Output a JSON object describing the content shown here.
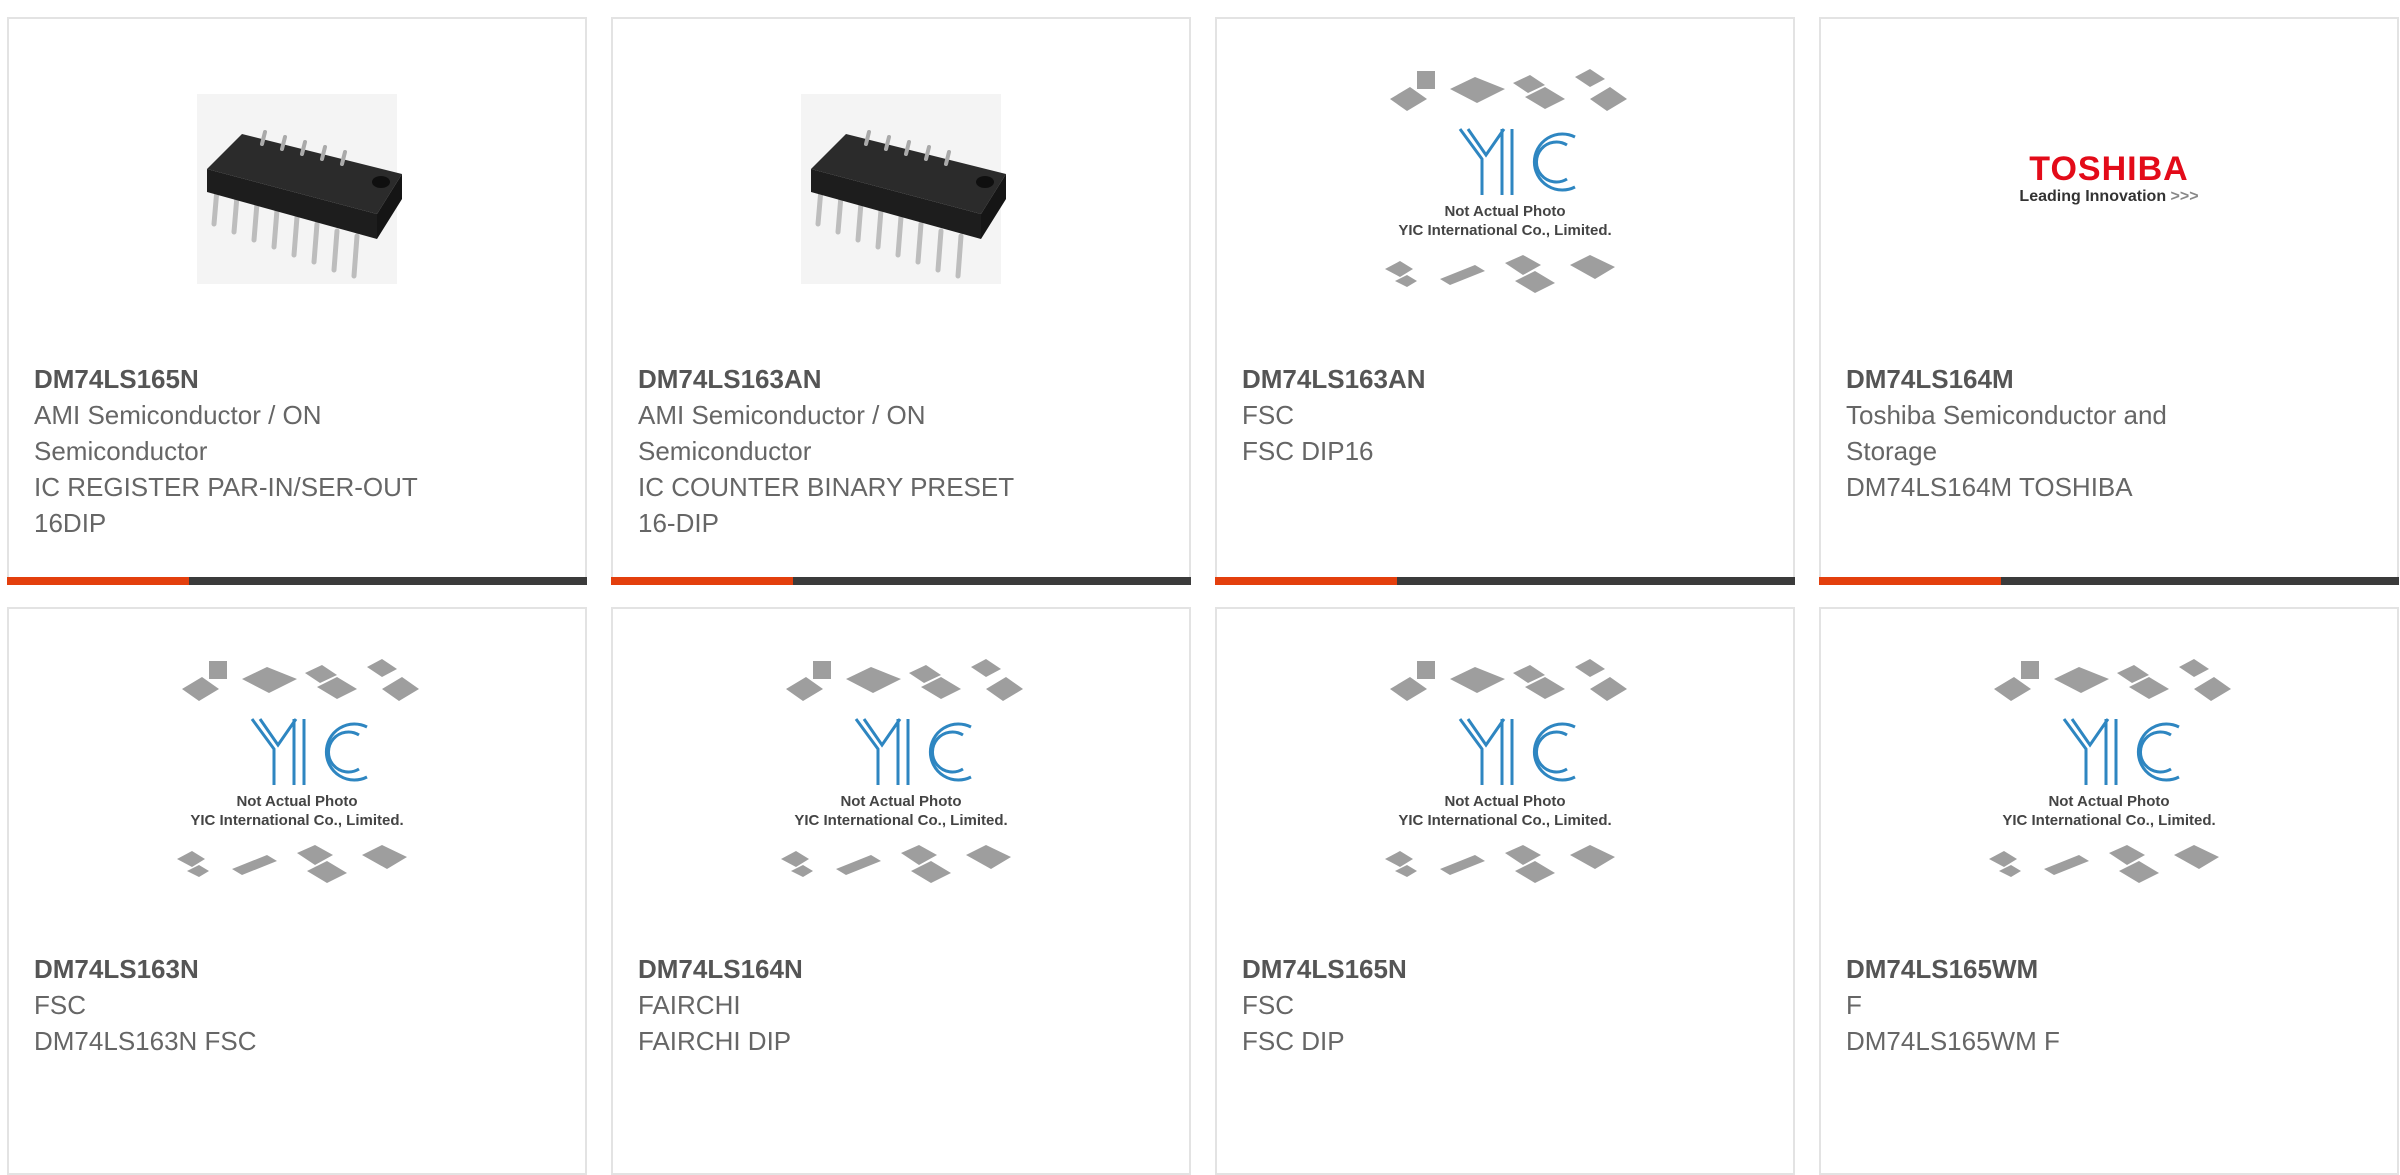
{
  "colors": {
    "accent": "#e33f0d",
    "bar": "#3b3b3b",
    "border": "#e3e3e3",
    "text_bold": "#555555",
    "text": "#666666"
  },
  "products": [
    {
      "part": "DM74LS165N",
      "lines": [
        "AMI Semiconductor / ON",
        "Semiconductor",
        "IC REGISTER PAR-IN/SER-OUT",
        "16DIP"
      ],
      "image": "dip16-chip-photo",
      "has_bar": true
    },
    {
      "part": "DM74LS163AN",
      "lines": [
        "AMI Semiconductor / ON",
        "Semiconductor",
        "IC COUNTER BINARY PRESET",
        "16-DIP"
      ],
      "image": "dip16-chip-photo",
      "has_bar": true
    },
    {
      "part": "DM74LS163AN",
      "lines": [
        "FSC",
        "FSC DIP16"
      ],
      "image": "yic-placeholder",
      "has_bar": true
    },
    {
      "part": "DM74LS164M",
      "lines": [
        "Toshiba Semiconductor and",
        "Storage",
        "DM74LS164M TOSHIBA"
      ],
      "image": "toshiba-logo",
      "has_bar": true
    },
    {
      "part": "DM74LS163N",
      "lines": [
        "FSC",
        "DM74LS163N FSC"
      ],
      "image": "yic-placeholder",
      "has_bar": false
    },
    {
      "part": "DM74LS164N",
      "lines": [
        "FAIRCHI",
        "FAIRCHI DIP"
      ],
      "image": "yic-placeholder",
      "has_bar": false
    },
    {
      "part": "DM74LS165N",
      "lines": [
        "FSC",
        "FSC DIP"
      ],
      "image": "yic-placeholder",
      "has_bar": false
    },
    {
      "part": "DM74LS165WM",
      "lines": [
        "F",
        "DM74LS165WM F"
      ],
      "image": "yic-placeholder",
      "has_bar": false
    }
  ],
  "placeholder": {
    "line1": "Not Actual Photo",
    "line2": "YIC International Co., Limited.",
    "logo": "YIC"
  },
  "toshiba_logo": {
    "brand": "TOSHIBA",
    "tagline": "Leading Innovation",
    "arrows": ">>>"
  }
}
